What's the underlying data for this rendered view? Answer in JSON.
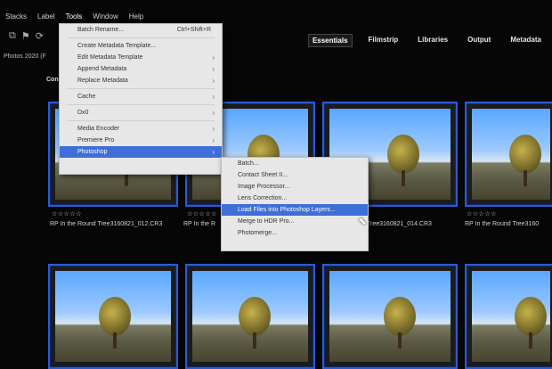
{
  "menubar": [
    "Stacks",
    "Label",
    "Tools",
    "Window",
    "Help"
  ],
  "toolbar": {
    "icons": [
      "stack-icon",
      "label-icon",
      "rotate-icon"
    ]
  },
  "path": "Photos 2020 (F",
  "panel_label": "Con",
  "workspaces": [
    "Essentials",
    "Filmstrip",
    "Libraries",
    "Output",
    "Metadata"
  ],
  "tools_menu": {
    "items": [
      {
        "label": "Batch Rename...",
        "shortcut": "Ctrl+Shift+R"
      },
      {
        "sep": true
      },
      {
        "label": "Create Metadata Template..."
      },
      {
        "label": "Edit Metadata Template",
        "submenu": true
      },
      {
        "label": "Append Metadata",
        "submenu": true
      },
      {
        "label": "Replace Metadata",
        "submenu": true
      },
      {
        "sep": true
      },
      {
        "label": "Cache",
        "submenu": true
      },
      {
        "sep": true
      },
      {
        "label": "Dx0",
        "submenu": true
      },
      {
        "sep": true
      },
      {
        "label": "Media Encoder",
        "submenu": true
      },
      {
        "label": "Premiere Pro",
        "submenu": true
      },
      {
        "label": "Photoshop",
        "submenu": true,
        "highlight": true
      }
    ]
  },
  "photoshop_submenu": {
    "items": [
      {
        "label": "Batch..."
      },
      {
        "label": "Contact Sheet II..."
      },
      {
        "label": "Image Processor..."
      },
      {
        "label": "Lens Correction..."
      },
      {
        "label": "Load Files into Photoshop Layers...",
        "highlight": true
      },
      {
        "label": "Merge to HDR Pro..."
      },
      {
        "label": "Photomerge..."
      }
    ]
  },
  "thumbnails_row1": [
    {
      "name": "RP In the Round Tree3160821_012.CR3",
      "stars": "☆☆☆☆☆"
    },
    {
      "name": "RP In the R",
      "stars": "☆☆☆☆☆"
    },
    {
      "name": "Tree3160821_014.CR3",
      "stars": ""
    },
    {
      "name": "RP In the Round Tree3160",
      "stars": "☆☆☆☆☆"
    }
  ],
  "thumbnails_row2": [
    {
      "name": "",
      "stars": ""
    },
    {
      "name": "",
      "stars": ""
    },
    {
      "name": "",
      "stars": ""
    },
    {
      "name": "",
      "stars": ""
    }
  ]
}
